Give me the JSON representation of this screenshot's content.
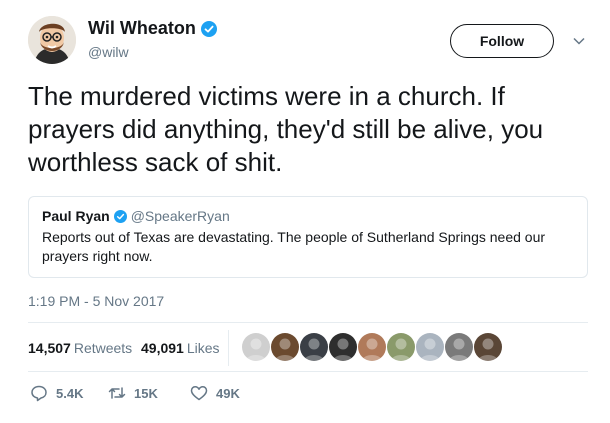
{
  "author": {
    "name": "Wil Wheaton",
    "handle": "@wilw",
    "verified": true,
    "avatar_icon": "cartoon-avatar-icon"
  },
  "follow_label": "Follow",
  "tweet_text": "The murdered victims were in a church. If prayers did anything, they'd still be alive, you worthless sack of shit.",
  "quoted": {
    "name": "Paul Ryan",
    "handle": "@SpeakerRyan",
    "verified": true,
    "text": "Reports out of Texas are devastating. The people of Sutherland Springs need our prayers right now."
  },
  "timestamp": "1:19 PM - 5 Nov 2017",
  "stats": {
    "retweets_count": "14,507",
    "retweets_label": "Retweets",
    "likes_count": "49,091",
    "likes_label": "Likes"
  },
  "likers": [
    {
      "color": "#cfcfcf"
    },
    {
      "color": "#6b4a2f"
    },
    {
      "color": "#3a3f46"
    },
    {
      "color": "#2e2e2e"
    },
    {
      "color": "#b07a5a"
    },
    {
      "color": "#8a9a6a"
    },
    {
      "color": "#aab4bf"
    },
    {
      "color": "#7a7a7a"
    },
    {
      "color": "#5a4636"
    }
  ],
  "actions": {
    "replies": "5.4K",
    "retweets": "15K",
    "likes": "49K"
  },
  "colors": {
    "verified_blue": "#1da1f2",
    "secondary_text": "#657786",
    "border": "#e1e8ed"
  }
}
